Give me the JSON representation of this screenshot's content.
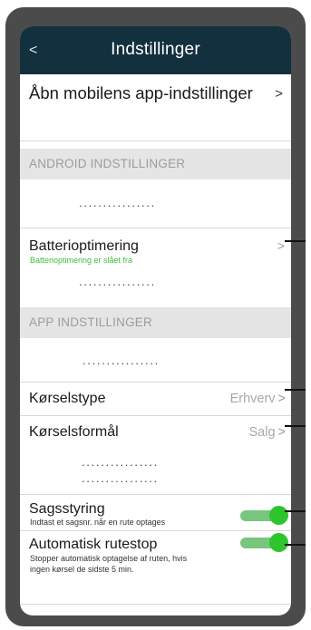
{
  "header": {
    "title": "Indstillinger",
    "back_label": "<"
  },
  "open_app_settings": {
    "label": "Åbn mobilens app-indstillinger",
    "chevron": ">"
  },
  "android_section": {
    "title": "ANDROID INDSTILLINGER",
    "dots": "................",
    "battery": {
      "label": "Batterioptimering",
      "status": "Batterioptimering er slået fra",
      "chevron": ">",
      "dots": "................"
    }
  },
  "app_section": {
    "title": "APP INDSTILLINGER",
    "dots": "................",
    "drive_type": {
      "label": "Kørselstype",
      "value": "Erhverv",
      "chevron": ">"
    },
    "drive_purpose": {
      "label": "Kørselsformål",
      "value": "Salg",
      "chevron": ">",
      "dots_1": "................",
      "dots_2": "................"
    },
    "case_management": {
      "label": "Sagsstyring",
      "description": "Indtast et sagsnr. når en rute optages",
      "enabled": true
    },
    "auto_stop": {
      "label": "Automatisk rutestop",
      "description_line1": "Stopper automatisk optagelse af ruten, hvis",
      "description_line2": "ingen kørsel de sidste 5 min.",
      "enabled": true
    }
  },
  "colors": {
    "header_bg": "#12303d",
    "device_frame": "#4b4b4b",
    "section_bg": "#e5e5e5",
    "toggle_on": "#2ec42e",
    "status_green": "#3bbf3b"
  }
}
